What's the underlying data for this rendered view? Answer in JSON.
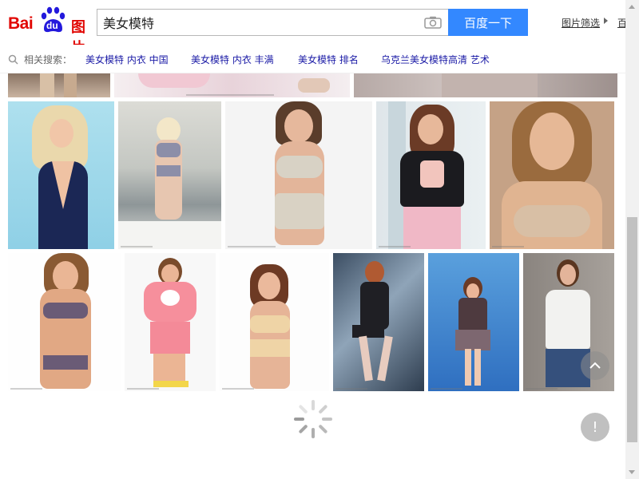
{
  "logo": {
    "bai": "Bai",
    "du": "du",
    "tupian": "图片"
  },
  "search": {
    "query": "美女模特",
    "button_label": "百度一下",
    "camera_icon": "camera-icon"
  },
  "header": {
    "filter_label": "图片筛选",
    "extra_label": "百度"
  },
  "related": {
    "label": "相关搜索：",
    "items": [
      "美女模特 内衣 中国",
      "美女模特 内衣 丰满",
      "美女模特 排名",
      "乌克兰美女模特高清 艺术"
    ]
  },
  "actions": {
    "back_to_top_icon": "chevron-up-icon",
    "feedback_label": "!"
  },
  "colors": {
    "brand_red": "#e10602",
    "brand_blue": "#2319dc",
    "button_blue": "#3388ff",
    "link_blue": "#1a1aa6"
  }
}
